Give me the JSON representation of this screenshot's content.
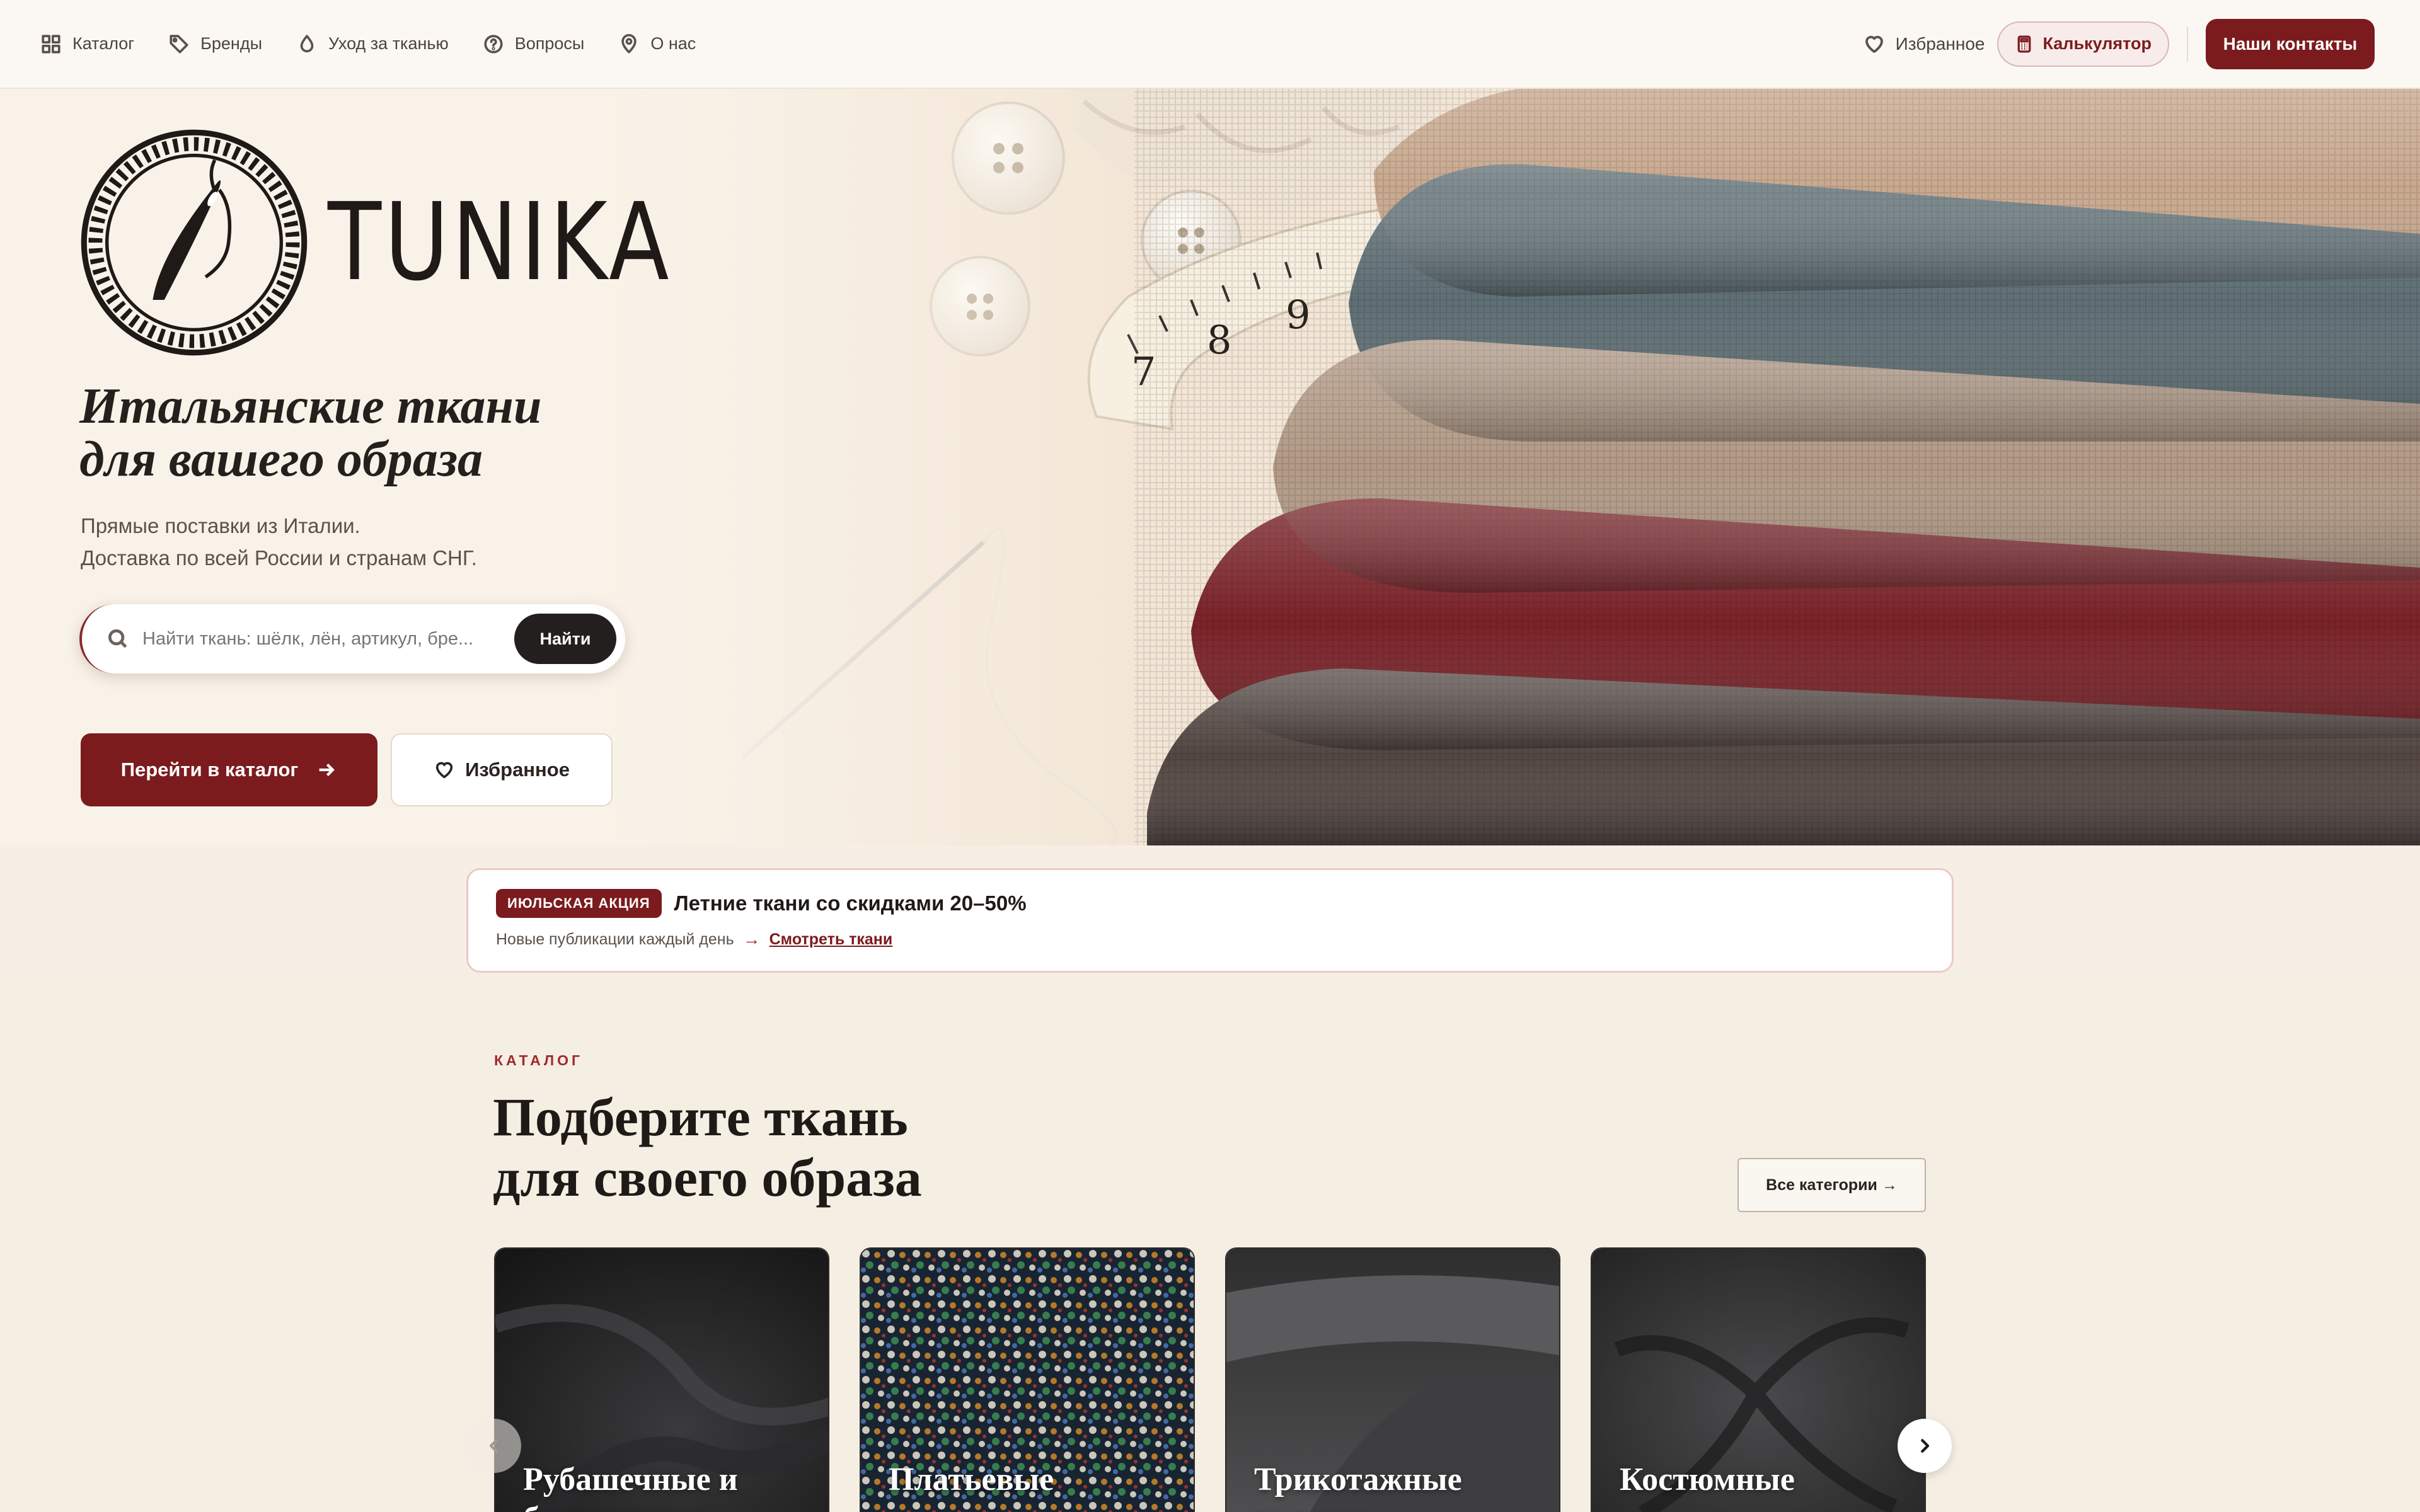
{
  "nav": {
    "items": [
      {
        "label": "Каталог",
        "icon": "grid-icon"
      },
      {
        "label": "Бренды",
        "icon": "tag-icon"
      },
      {
        "label": "Уход за тканью",
        "icon": "drop-icon"
      },
      {
        "label": "Вопросы",
        "icon": "question-icon"
      },
      {
        "label": "О нас",
        "icon": "location-pin-icon"
      }
    ],
    "favorites_label": "Избранное",
    "calculator_label": "Калькулятор",
    "contacts_label": "Наши контакты"
  },
  "hero": {
    "brand_name": "TUNIKA",
    "title_line1": "Итальянские ткани",
    "title_line2": "для вашего образа",
    "subtitle_line1": "Прямые поставки из Италии.",
    "subtitle_line2": "Доставка по всей России и странам СНГ.",
    "search_placeholder": "Найти ткань: шёлк, лён, артикул, бре...",
    "search_button": "Найти",
    "catalog_button": "Перейти в каталог",
    "favorites_button": "Избранное"
  },
  "promo": {
    "badge": "ИЮЛЬСКАЯ АКЦИЯ",
    "title": "Летние ткани со скидками 20–50%",
    "note": "Новые публикации каждый день",
    "arrow": "→",
    "link": "Смотреть ткани"
  },
  "catalog": {
    "eyebrow": "КАТАЛОГ",
    "title_line1": "Подберите ткань",
    "title_line2": "для своего образа",
    "all_categories": "Все категории →",
    "cards": [
      {
        "label": "Рубашечные и блузочные"
      },
      {
        "label": "Платьевые"
      },
      {
        "label": "Трикотажные полотна"
      },
      {
        "label": "Костюмные"
      }
    ]
  },
  "colors": {
    "brand": "#7b1b1e",
    "background": "#f5eee3",
    "dark": "#221f1e"
  }
}
